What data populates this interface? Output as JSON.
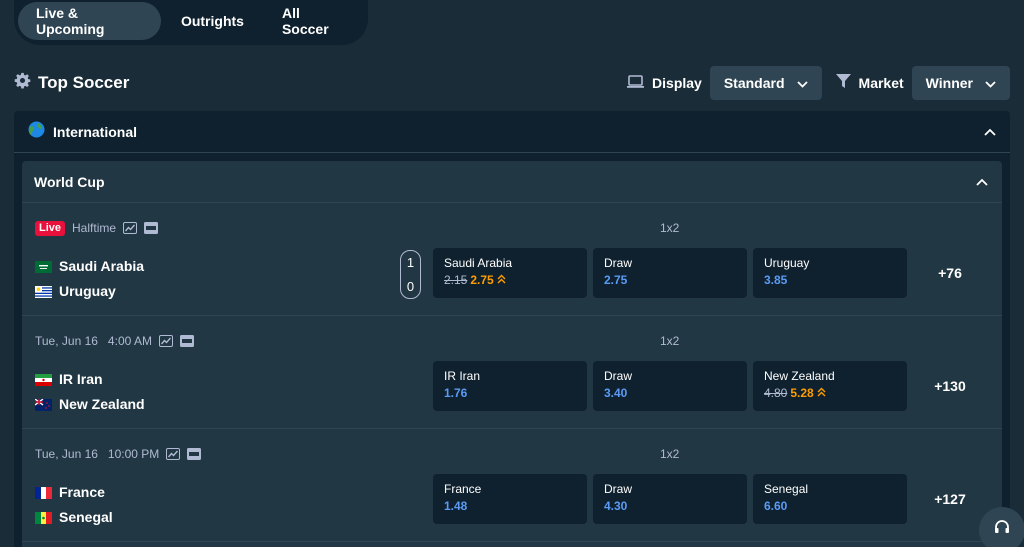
{
  "tabs": [
    {
      "label": "Live & Upcoming",
      "active": true
    },
    {
      "label": "Outrights",
      "active": false
    },
    {
      "label": "All Soccer",
      "active": false
    }
  ],
  "header": {
    "title": "Top Soccer",
    "display_label": "Display",
    "display_value": "Standard",
    "market_label": "Market",
    "market_value": "Winner"
  },
  "section": {
    "label": "International"
  },
  "league": {
    "label": "World Cup"
  },
  "matches": [
    {
      "live": true,
      "live_label": "Live",
      "status": "Halftime",
      "market": "1x2",
      "team1": "Saudi Arabia",
      "team2": "Uruguay",
      "score1": "1",
      "score2": "0",
      "odds": [
        {
          "label": "Saudi Arabia",
          "old": "2.15",
          "price": "2.75",
          "trend": "up"
        },
        {
          "label": "Draw",
          "price": "2.75"
        },
        {
          "label": "Uruguay",
          "price": "3.85"
        }
      ],
      "more": "+76"
    },
    {
      "live": false,
      "status": "Tue, Jun 16   4:00 AM",
      "market": "1x2",
      "team1": "IR Iran",
      "team2": "New Zealand",
      "odds": [
        {
          "label": "IR Iran",
          "price": "1.76"
        },
        {
          "label": "Draw",
          "price": "3.40"
        },
        {
          "label": "New Zealand",
          "old": "4.80",
          "price": "5.28",
          "trend": "up"
        }
      ],
      "more": "+130"
    },
    {
      "live": false,
      "status": "Tue, Jun 16   10:00 PM",
      "market": "1x2",
      "team1": "France",
      "team2": "Senegal",
      "odds": [
        {
          "label": "France",
          "price": "1.48"
        },
        {
          "label": "Draw",
          "price": "4.30"
        },
        {
          "label": "Senegal",
          "price": "6.60"
        }
      ],
      "more": "+127"
    }
  ],
  "colors": {
    "background": "#1a2c38",
    "panel": "#0f212e",
    "card": "#213743",
    "odds_blue": "#5b9bf5",
    "odds_up": "#ff9d00",
    "live_red": "#e9113c"
  }
}
